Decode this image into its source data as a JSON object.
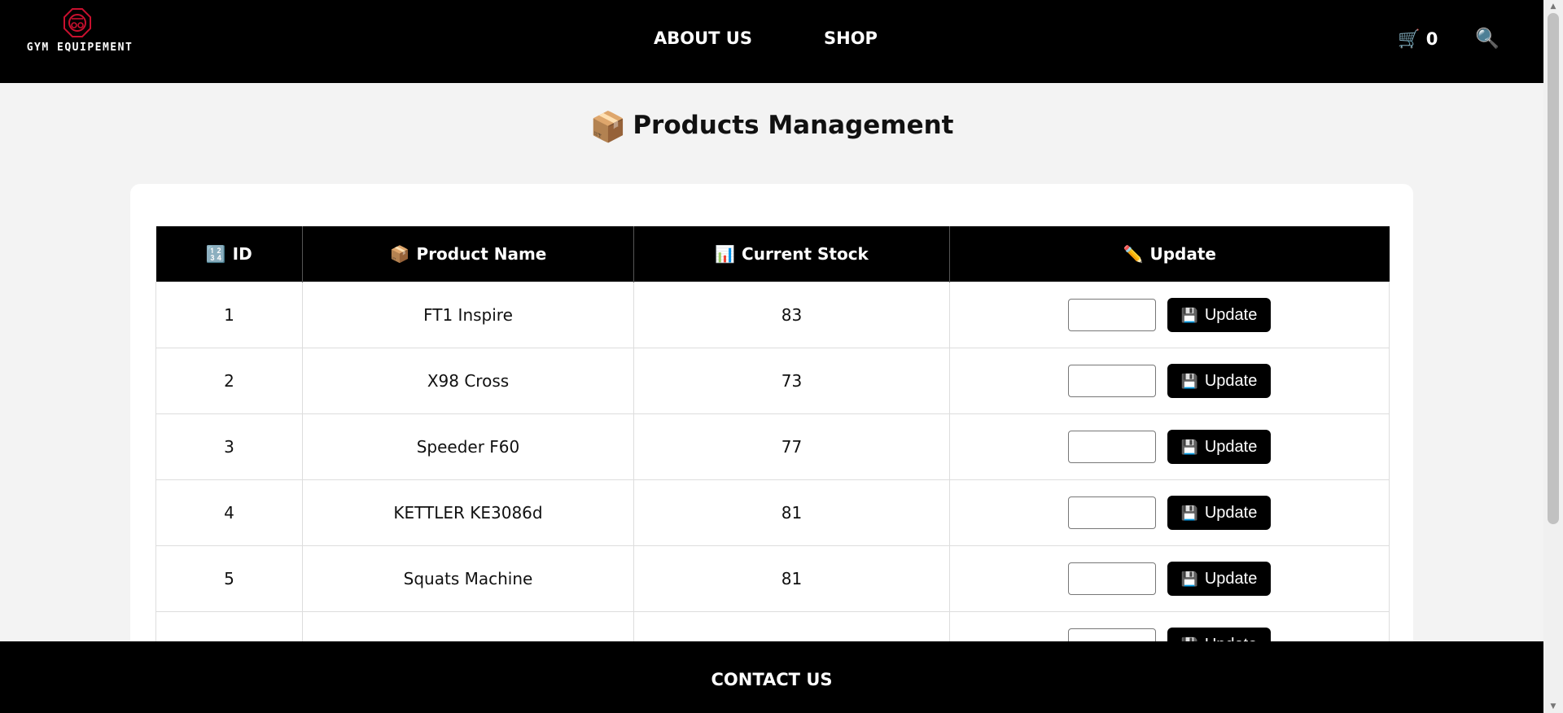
{
  "header": {
    "brand": "GYM EQUIPEMENT",
    "nav": [
      "ABOUT US",
      "SHOP"
    ],
    "cart_glyph": "🛒",
    "cart_count": "0",
    "search_glyph": "🔍"
  },
  "page": {
    "title_icon": "📦",
    "title": "Products Management"
  },
  "table": {
    "columns": [
      {
        "icon": "🔢",
        "label": "ID"
      },
      {
        "icon": "📦",
        "label": "Product Name"
      },
      {
        "icon": "📊",
        "label": "Current Stock"
      },
      {
        "icon": "✏️",
        "label": "Update"
      }
    ],
    "update_button_icon": "💾",
    "update_button_label": "Update",
    "rows": [
      {
        "id": "1",
        "name": "FT1 Inspire",
        "stock": "83",
        "input_value": ""
      },
      {
        "id": "2",
        "name": "X98 Cross",
        "stock": "73",
        "input_value": ""
      },
      {
        "id": "3",
        "name": "Speeder F60",
        "stock": "77",
        "input_value": ""
      },
      {
        "id": "4",
        "name": "KETTLER KE3086d",
        "stock": "81",
        "input_value": ""
      },
      {
        "id": "5",
        "name": "Squats Machine",
        "stock": "81",
        "input_value": ""
      }
    ]
  },
  "footer": {
    "link": "CONTACT US"
  },
  "colors": {
    "header_bg": "#000000",
    "logo_accent": "#c8102e",
    "page_bg": "#f3f3f3"
  }
}
